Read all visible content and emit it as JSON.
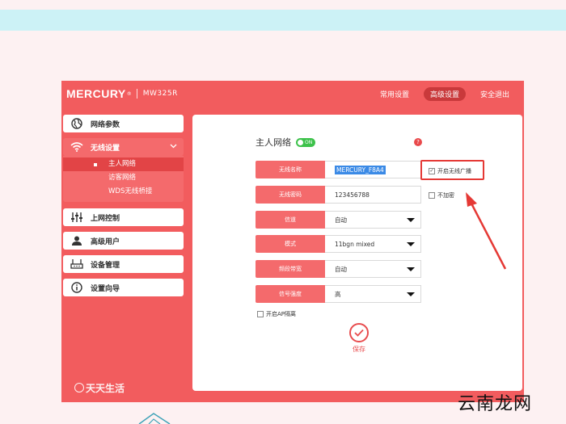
{
  "brand": {
    "logo": "MERCURY",
    "trademark": "®",
    "model": "MW325R"
  },
  "topnav": [
    {
      "label": "常用设置",
      "active": false
    },
    {
      "label": "高级设置",
      "active": true
    },
    {
      "label": "安全退出",
      "active": false
    }
  ],
  "menu": {
    "network_params": "网络参数",
    "wireless": "无线设置",
    "sub_host": "主人网络",
    "sub_guest": "访客网络",
    "sub_wds": "WDS无线桥接",
    "access_control": "上网控制",
    "advanced_user": "高级用户",
    "device_mgmt": "设备管理",
    "setup_wizard": "设置向导"
  },
  "panel": {
    "title": "主人网络",
    "toggle": "ON",
    "help": "?",
    "fields": {
      "ssid_label": "无线名称",
      "ssid_value": "MERCURY_F8A4",
      "password_label": "无线密码",
      "password_value": "123456788",
      "channel_label": "信道",
      "channel_value": "自动",
      "mode_label": "模式",
      "mode_value": "11bgn mixed",
      "bandwidth_label": "频段带宽",
      "bandwidth_value": "自动",
      "signal_label": "信号强度",
      "signal_value": "高"
    },
    "broadcast_label": "开启无线广播",
    "encrypt_label": "不加密",
    "ap_isolation_label": "开启AP隔离",
    "save_label": "保存"
  },
  "watermarks": {
    "left": "天天生活",
    "right": "云南龙网"
  },
  "colors": {
    "brand_red": "#f25c5e",
    "active_red": "#e24446",
    "toggle_green": "#3dc24b",
    "annotation_red": "#e53935"
  }
}
